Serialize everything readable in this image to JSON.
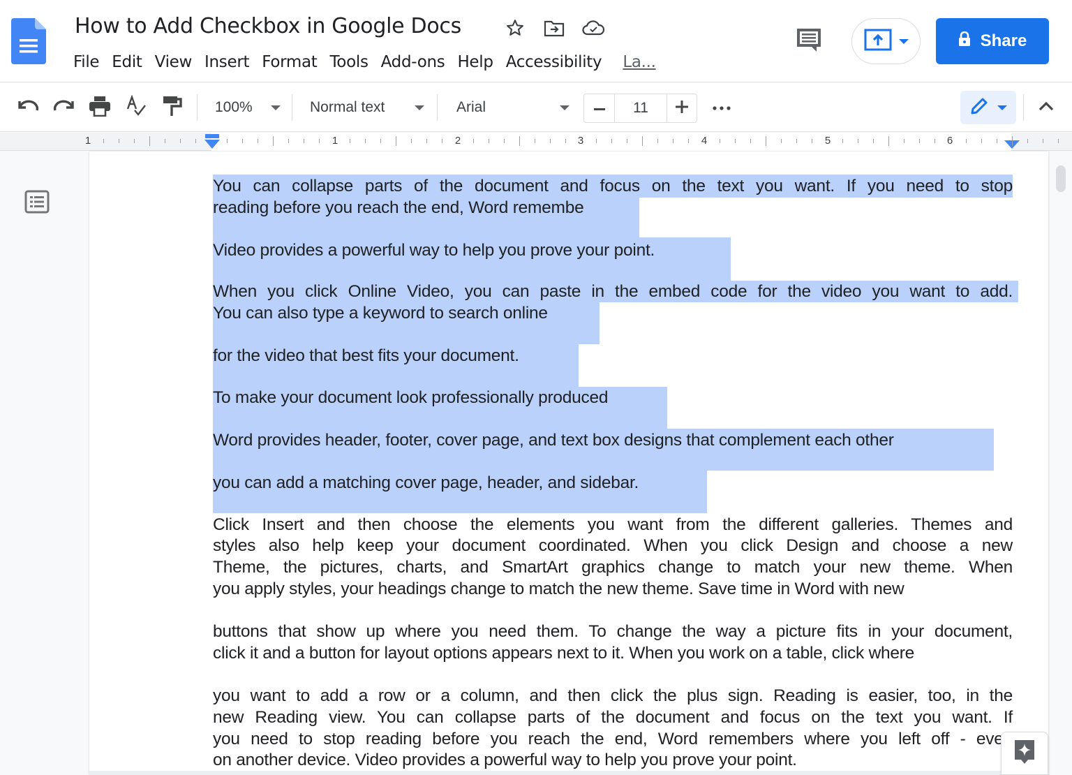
{
  "app": {
    "title": "How to Add Checkbox in Google Docs",
    "brand_color": "#1a73e8",
    "selection_color": "#b9d1fb"
  },
  "header": {
    "title_icons": [
      {
        "name": "star-icon",
        "label": "Star"
      },
      {
        "name": "move-to-folder-icon",
        "label": "Move"
      },
      {
        "name": "cloud-saved-icon",
        "label": "Document status"
      }
    ],
    "menu": [
      "File",
      "Edit",
      "View",
      "Insert",
      "Format",
      "Tools",
      "Add-ons",
      "Help",
      "Accessibility",
      "La..."
    ],
    "comment_icon": "comment-history-icon",
    "present_icon": "present-icon",
    "share": {
      "label": "Share",
      "icon": "lock-icon"
    }
  },
  "toolbar": {
    "zoom": "100%",
    "style": "Normal text",
    "font": "Arial",
    "font_size": "11",
    "more_icon": "more-horizontal-icon",
    "mode_icon": "pencil-icon"
  },
  "ruler": {
    "labels": [
      "1",
      "1",
      "2",
      "3",
      "4",
      "5",
      "6"
    ]
  },
  "document": {
    "lines": [
      {
        "text": "You can collapse parts of the document and focus on the text you want. If you need to stop",
        "justify": true
      },
      {
        "text": "reading before you reach the end, Word remembe",
        "justify": false
      },
      {
        "text": " Video provides a powerful way to help you prove your point.",
        "justify": false
      },
      {
        "text": "When you click Online Video, you can paste in the embed code for the video you want to add.",
        "justify": true
      },
      {
        "text": "You can also type a keyword to search online",
        "justify": false
      },
      {
        "text": " for the video that best fits your document.",
        "justify": false
      },
      {
        "text": "To make your document look professionally produced",
        "justify": false
      },
      {
        "text": " Word provides header, footer, cover page, and text box designs that complement each other",
        "justify": false
      },
      {
        "text": " you can add a matching cover page, header, and sidebar.",
        "justify": false
      },
      {
        "text": "Click Insert and then choose the elements you want from the different galleries. Themes and",
        "justify": true
      },
      {
        "text": "styles also help keep your document coordinated. When you click Design and choose a new",
        "justify": true
      },
      {
        "text": "Theme, the pictures, charts, and SmartArt graphics change to match your new theme. When",
        "justify": true
      },
      {
        "text": "you apply styles, your headings change to match the new theme. Save time in Word with new",
        "justify": false
      },
      {
        "text": "buttons that show up where you need them. To change the way a picture fits in your document,",
        "justify": true
      },
      {
        "text": "click it and a button for layout options appears next to it. When you work on a table, click where",
        "justify": false
      },
      {
        "text": "you want to add a row or a column, and then click the plus sign. Reading is easier, too, in the",
        "justify": true
      },
      {
        "text": "new Reading view. You can collapse parts of the document and focus on the text you want. If",
        "justify": true
      },
      {
        "text": "you need to stop reading before you reach the end, Word remembers where you left off - even",
        "justify": true
      },
      {
        "text": "on another device. Video provides a powerful way to help you prove your point.",
        "justify": false
      }
    ]
  }
}
